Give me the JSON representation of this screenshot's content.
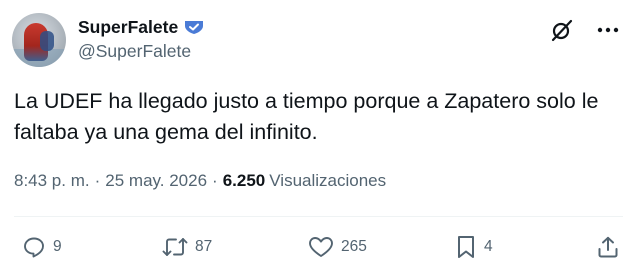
{
  "author": {
    "display_name": "SuperFalete",
    "handle": "@SuperFalete",
    "verified_badge_icon": "verified-badge-icon",
    "badge_color": "#4a7bd6"
  },
  "header_icons": [
    "grok-icon",
    "more-icon"
  ],
  "tweet": {
    "line1": "La UDEF ha llegado justo a tiempo porque a Zapatero solo le",
    "line2": "faltaba ya una gema del infinito."
  },
  "meta": {
    "time": "8:43 p. m.",
    "separator": "·",
    "date": "25 may. 2026",
    "views_count": "6.250",
    "views_label": "Visualizaciones"
  },
  "actions": {
    "reply": {
      "icon": "reply-icon",
      "count": "9"
    },
    "retweet": {
      "icon": "retweet-icon",
      "count": "87"
    },
    "like": {
      "icon": "heart-icon",
      "count": "265"
    },
    "bookmark": {
      "icon": "bookmark-icon",
      "count": "4"
    },
    "share": {
      "icon": "share-icon"
    }
  },
  "colors": {
    "text": "#0f1419",
    "secondary": "#536471",
    "divider": "#eff3f4"
  }
}
